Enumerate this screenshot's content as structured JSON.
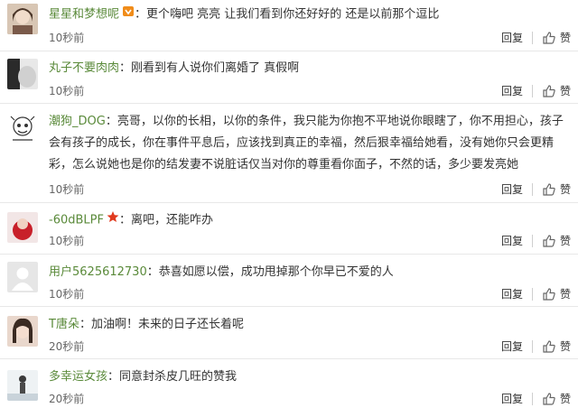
{
  "comments": [
    {
      "username": "星星和梦想呢",
      "badge": "vip",
      "text": "更个嗨吧 亮亮 让我们看到你还好好的 还是以前那个逗比",
      "time": "10秒前",
      "reply": "回复",
      "like": "赞"
    },
    {
      "username": "丸子不要肉肉",
      "text": "刚看到有人说你们离婚了 真假啊",
      "time": "10秒前",
      "reply": "回复",
      "like": "赞"
    },
    {
      "username": "潮狗_DOG",
      "text": "亮哥，以你的长相，以你的条件，我只能为你抱不平地说你眼瞎了，你不用担心，孩子会有孩子的成长，你在事件平息后，应该找到真正的幸福，然后狠幸福给她看，没有她你只会更精彩，怎么说她也是你的结发妻不说脏话仅当对你的尊重看你面子，不然的话，多少要发亮她",
      "time": "10秒前",
      "reply": "回复",
      "like": "赞"
    },
    {
      "username": "-60dBLPF",
      "badge": "star",
      "text": "离吧，还能咋办",
      "time": "10秒前",
      "reply": "回复",
      "like": "赞"
    },
    {
      "username": "用户5625612730",
      "text": "恭喜如愿以偿，成功甩掉那个你早已不爱的人",
      "time": "10秒前",
      "reply": "回复",
      "like": "赞"
    },
    {
      "username": "T唐朵",
      "text": "加油啊！未来的日子还长着呢",
      "time": "20秒前",
      "reply": "回复",
      "like": "赞"
    },
    {
      "username": "多幸运女孩",
      "text": "同意封杀皮几旺的赞我",
      "time": "20秒前",
      "reply": "回复",
      "like": "赞"
    }
  ],
  "colors": {
    "username": "#5a8a3a",
    "text": "#333333",
    "divider": "#e8e8e8",
    "badge_star": "#e03a1e",
    "badge_vip": "#f08c1a"
  }
}
